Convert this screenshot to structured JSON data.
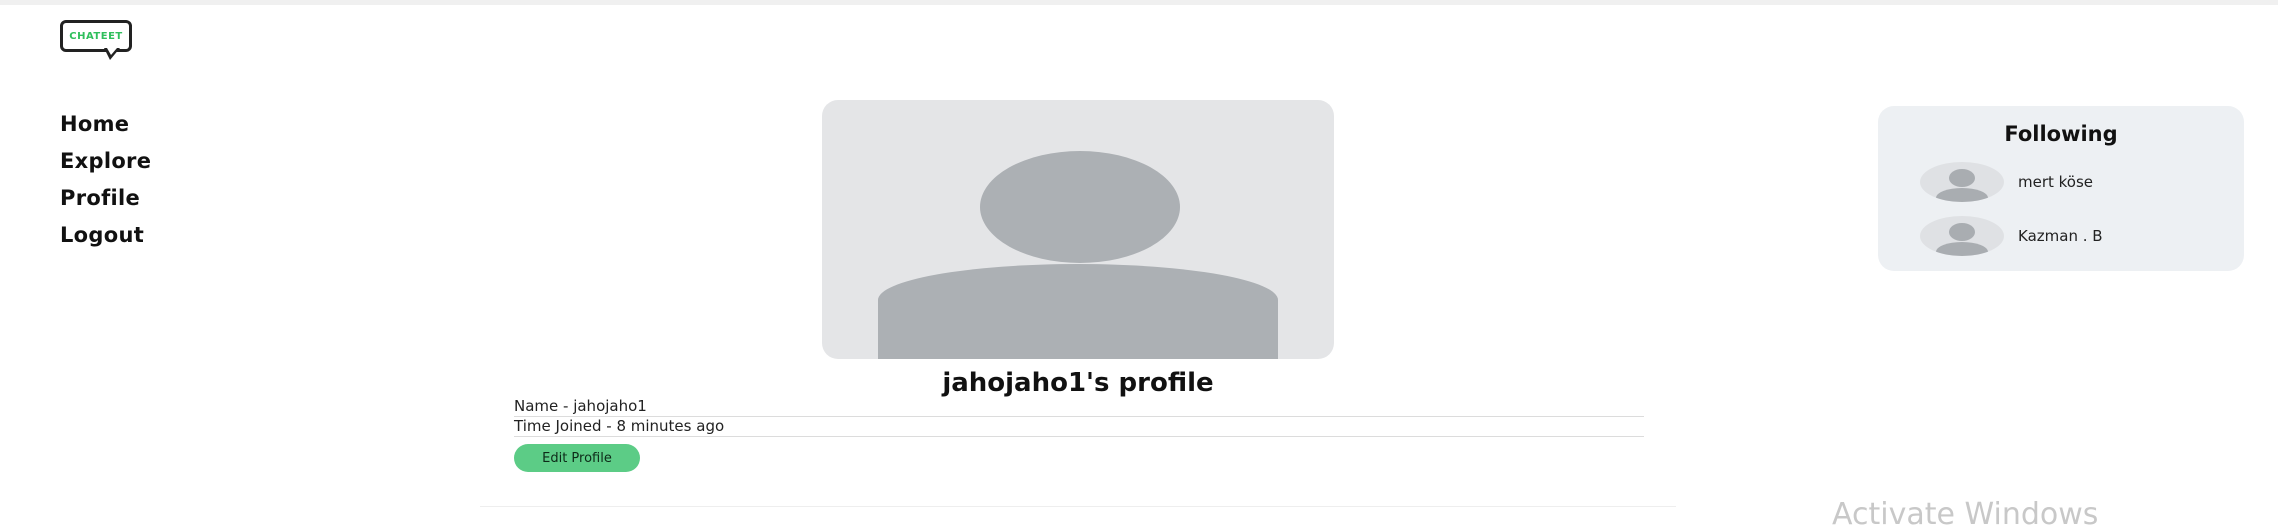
{
  "logo": {
    "text": "CHATEET"
  },
  "nav": {
    "items": [
      {
        "label": "Home"
      },
      {
        "label": "Explore"
      },
      {
        "label": "Profile"
      },
      {
        "label": "Logout"
      }
    ]
  },
  "profile": {
    "title": "jahojaho1's profile",
    "name_line": "Name - jahojaho1",
    "joined_line": "Time Joined - 8 minutes ago",
    "edit_label": "Edit Profile"
  },
  "following": {
    "title": "Following",
    "users": [
      {
        "name": "mert köse"
      },
      {
        "name": "Kazman . B"
      }
    ]
  },
  "watermark": {
    "text": "Activate Windows"
  },
  "colors": {
    "accent": "#5ccc86",
    "logo_green": "#2fbf5c",
    "panel_bg": "#edf0f3",
    "avatar_bg": "#e4e5e7",
    "avatar_fg": "#acb0b4"
  }
}
